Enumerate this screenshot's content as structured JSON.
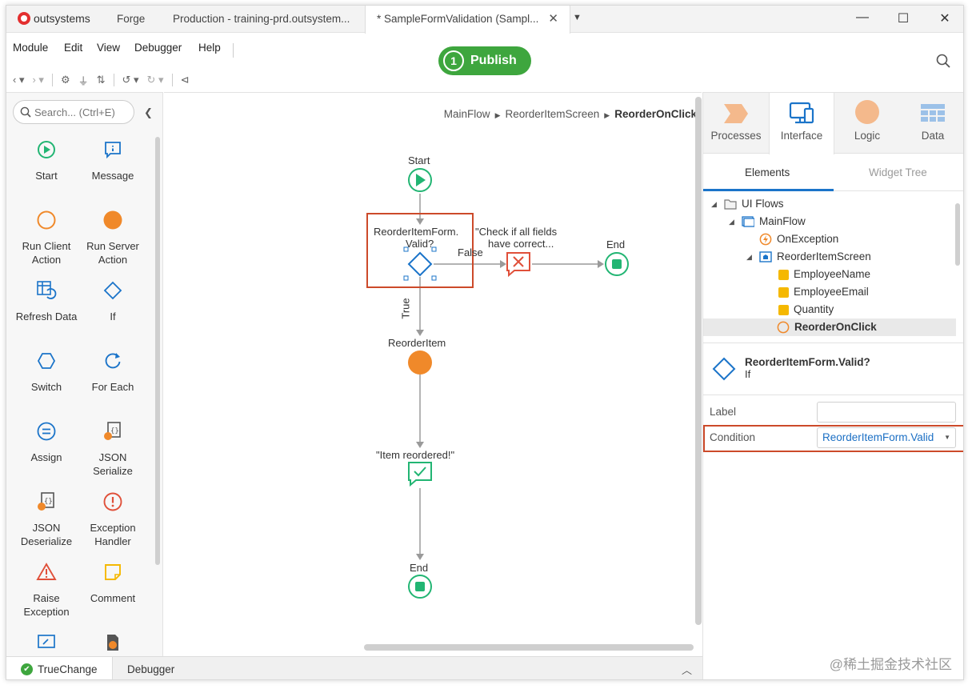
{
  "titlebar": {
    "logo_text": "outsystems",
    "tabs": [
      {
        "label": "Forge"
      },
      {
        "label": "Production - training-prd.outsystem..."
      },
      {
        "label": "* SampleFormValidation (Sampl..."
      }
    ],
    "close_glyph": "✕"
  },
  "menu": [
    "Module",
    "Edit",
    "View",
    "Debugger",
    "Help"
  ],
  "publish": {
    "number": "1",
    "label": "Publish",
    "color": "#3ea63e"
  },
  "toolbox": {
    "search_placeholder": "Search... (Ctrl+E)",
    "tools": [
      {
        "label": "Start",
        "icon": "start-icon"
      },
      {
        "label": "Message",
        "icon": "message-icon"
      },
      {
        "label": "Run Client Action",
        "icon": "run-client-action-icon"
      },
      {
        "label": "Run Server Action",
        "icon": "run-server-action-icon"
      },
      {
        "label": "Refresh Data",
        "icon": "refresh-data-icon"
      },
      {
        "label": "If",
        "icon": "if-icon"
      },
      {
        "label": "Switch",
        "icon": "switch-icon"
      },
      {
        "label": "For Each",
        "icon": "for-each-icon"
      },
      {
        "label": "Assign",
        "icon": "assign-icon"
      },
      {
        "label": "JSON Serialize",
        "icon": "json-serialize-icon"
      },
      {
        "label": "JSON Deserialize",
        "icon": "json-deserialize-icon"
      },
      {
        "label": "Exception Handler",
        "icon": "exception-handler-icon"
      },
      {
        "label": "Raise Exception",
        "icon": "raise-exception-icon"
      },
      {
        "label": "Comment",
        "icon": "comment-icon"
      }
    ]
  },
  "canvas": {
    "breadcrumb": [
      "MainFlow",
      "ReorderItemScreen",
      "ReorderOnClick"
    ],
    "nodes": {
      "start": "Start",
      "if_line1": "ReorderItemForm.",
      "if_line2": "Valid?",
      "message_line1": "\"Check if all fields",
      "message_line2": "have correct...",
      "end_right": "End",
      "false_label": "False",
      "true_label": "True",
      "reorder": "ReorderItem",
      "item_reordered": "\"Item reordered!\"",
      "end_bottom": "End"
    }
  },
  "right_panel": {
    "tabs": [
      "Processes",
      "Interface",
      "Logic",
      "Data"
    ],
    "subtabs": [
      "Elements",
      "Widget Tree"
    ],
    "tree": [
      {
        "label": "UI Flows"
      },
      {
        "label": "MainFlow"
      },
      {
        "label": "OnException"
      },
      {
        "label": "ReorderItemScreen"
      },
      {
        "label": "EmployeeName"
      },
      {
        "label": "EmployeeEmail"
      },
      {
        "label": "Quantity"
      },
      {
        "label": "ReorderOnClick"
      }
    ],
    "properties": {
      "title": "ReorderItemForm.Valid?",
      "type": "If",
      "label_name": "Label",
      "label_value": "",
      "condition_name": "Condition",
      "condition_value": "ReorderItemForm.Valid"
    }
  },
  "bottom": {
    "tabs": [
      "TrueChange",
      "Debugger"
    ]
  },
  "watermark": "@稀土掘金技术社区",
  "colors": {
    "accent": "#1b74c9",
    "highlight": "#cc4a2a",
    "success": "#22b573",
    "server": "#f0892a",
    "error": "#e0503a"
  }
}
